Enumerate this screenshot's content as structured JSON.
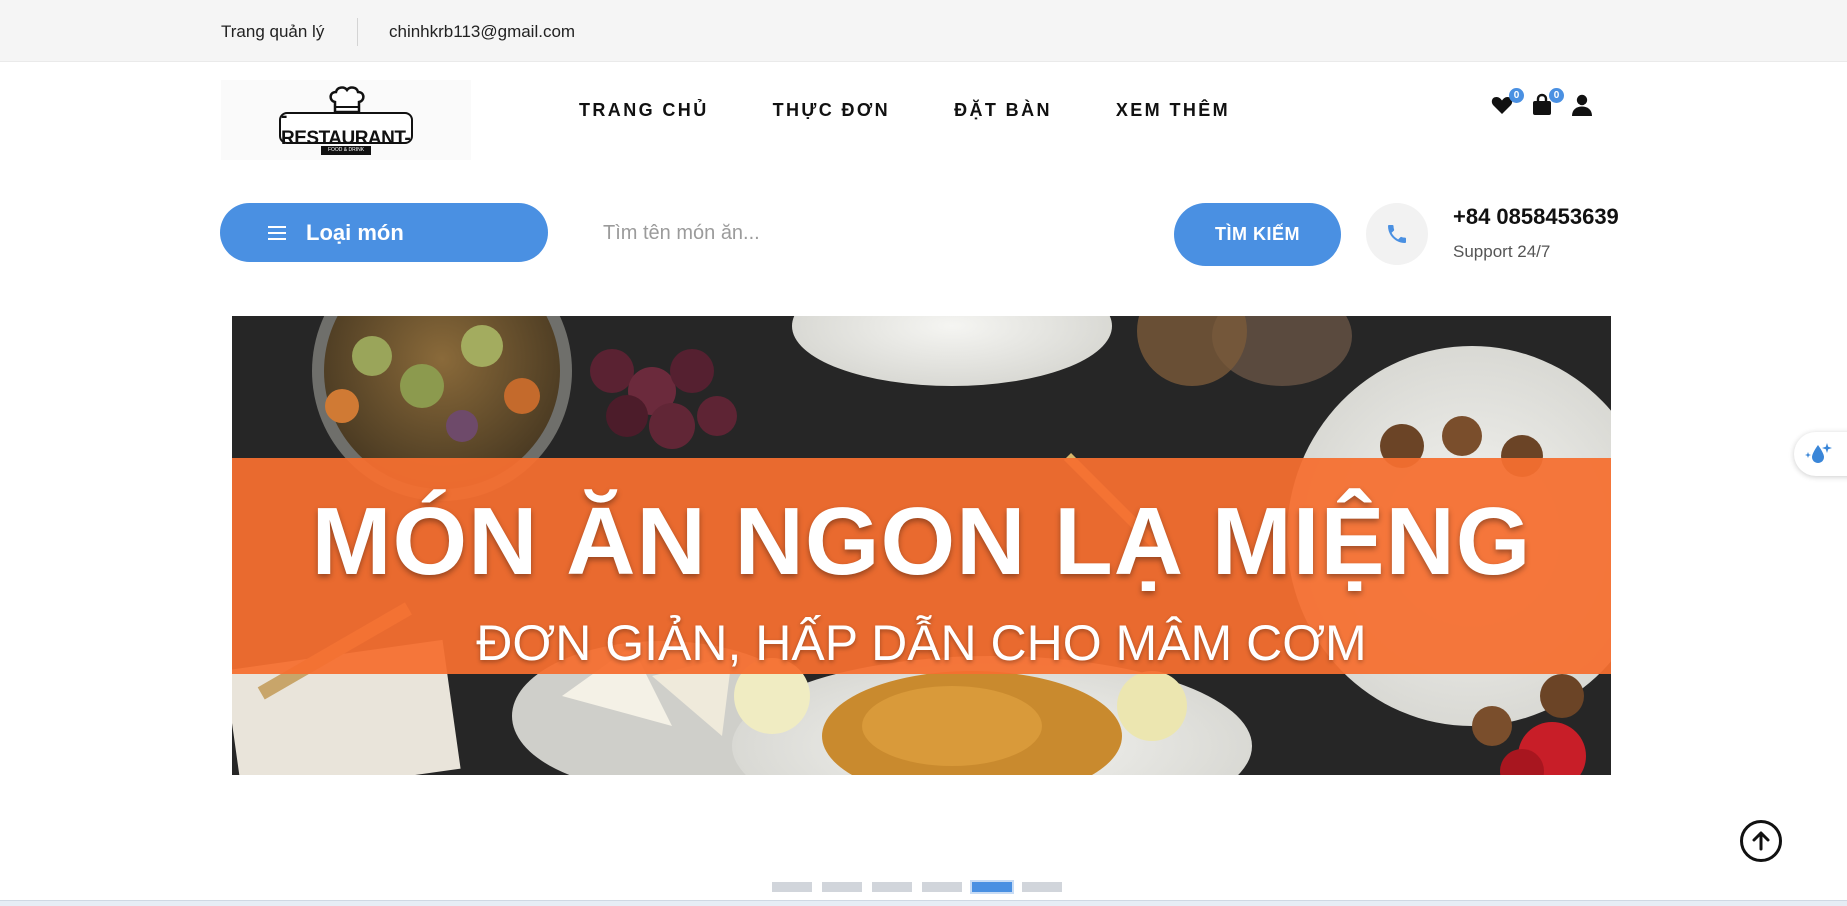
{
  "topbar": {
    "admin_link": "Trang quản lý",
    "email": "chinhkrb113@gmail.com"
  },
  "logo": {
    "text": "-RESTAURANT-",
    "subtext": "FOOD & DRINK"
  },
  "nav": {
    "items": [
      {
        "label": "TRANG CHỦ"
      },
      {
        "label": "THỰC ĐƠN"
      },
      {
        "label": "ĐẶT BÀN"
      },
      {
        "label": "XEM THÊM"
      }
    ]
  },
  "header_icons": {
    "wishlist_count": "0",
    "cart_count": "0",
    "icons": [
      "heart-icon",
      "shopping-bag-icon",
      "user-icon"
    ]
  },
  "search": {
    "category_label": "Loại món",
    "placeholder": "Tìm tên món ăn...",
    "value": "",
    "button_label": "TÌM KIẾM"
  },
  "contact": {
    "phone": "+84 0858453639",
    "support": "Support 24/7"
  },
  "banner": {
    "title": "MÓN ĂN NGON LẠ MIỆNG",
    "subtitle": "ĐƠN GIẢN, HẤP DẪN CHO MÂM CƠM"
  },
  "slider": {
    "total": 6,
    "active_index": 4
  },
  "colors": {
    "accent": "#4a90e2",
    "banner_orange": "#f26a2e",
    "topbar_bg": "#f5f5f5"
  }
}
